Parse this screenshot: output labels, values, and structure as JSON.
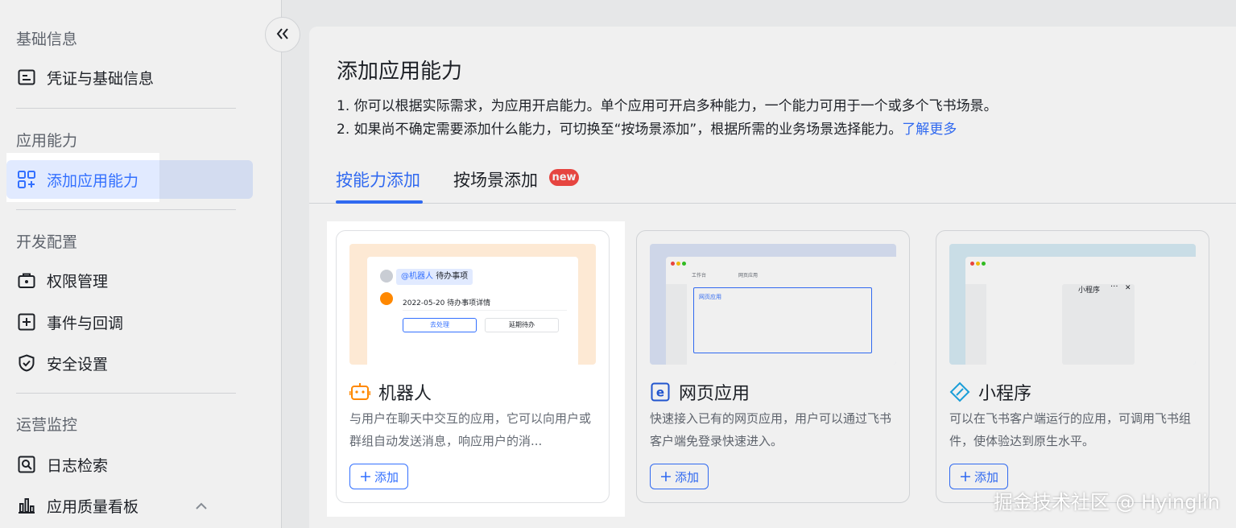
{
  "sidebar": {
    "groups": [
      {
        "title": "基础信息",
        "items": [
          {
            "label": "凭证与基础信息",
            "icon": "credential-icon"
          }
        ]
      },
      {
        "title": "应用能力",
        "items": [
          {
            "label": "添加应用能力",
            "icon": "add-app-icon"
          }
        ]
      },
      {
        "title": "开发配置",
        "items": [
          {
            "label": "权限管理",
            "icon": "permission-icon"
          },
          {
            "label": "事件与回调",
            "icon": "event-icon"
          },
          {
            "label": "安全设置",
            "icon": "shield-icon"
          }
        ]
      },
      {
        "title": "运营监控",
        "items": [
          {
            "label": "日志检索",
            "icon": "log-search-icon"
          },
          {
            "label": "应用质量看板",
            "icon": "chart-icon"
          }
        ]
      }
    ]
  },
  "main": {
    "title": "添加应用能力",
    "desc1": "1. 你可以根据实际需求，为应用开启能力。单个应用可开启多种能力，一个能力可用于一个或多个飞书场景。",
    "desc2": "2. 如果尚不确定需要添加什么能力，可切换至“按场景添加”，根据所需的业务场景选择能力。",
    "learn_more": "了解更多",
    "tabs": [
      {
        "label": "按能力添加",
        "active": true
      },
      {
        "label": "按场景添加",
        "badge": "new"
      }
    ]
  },
  "cards": [
    {
      "title": "机器人",
      "desc": "与用户在聊天中交互的应用，它可以向用户或群组自动发送消息，响应用户的消...",
      "add_label": "添加",
      "thumb": {
        "tag": "@机器人",
        "tag_text": "待办事项",
        "line": "2022-05-20 待办事项详情",
        "btn1": "去处理",
        "btn2": "延期待办"
      }
    },
    {
      "title": "网页应用",
      "desc": "快速接入已有的网页应用，用户可以通过飞书客户端免登录快速进入。",
      "add_label": "添加",
      "thumb": {
        "tab1": "工作台",
        "tab2": "网页应用",
        "label": "网页应用"
      }
    },
    {
      "title": "小程序",
      "desc": "可以在飞书客户端运行的应用，可调用飞书组件，使体验达到原生水平。",
      "add_label": "添加",
      "thumb": {
        "label": "小程序",
        "dots": "···",
        "close": "✕"
      }
    }
  ],
  "watermark": "掘金技术社区 @ Hyinglin",
  "colors": {
    "accent": "#3370ff",
    "badge": "#f54a45",
    "robot": "#ff8800"
  }
}
